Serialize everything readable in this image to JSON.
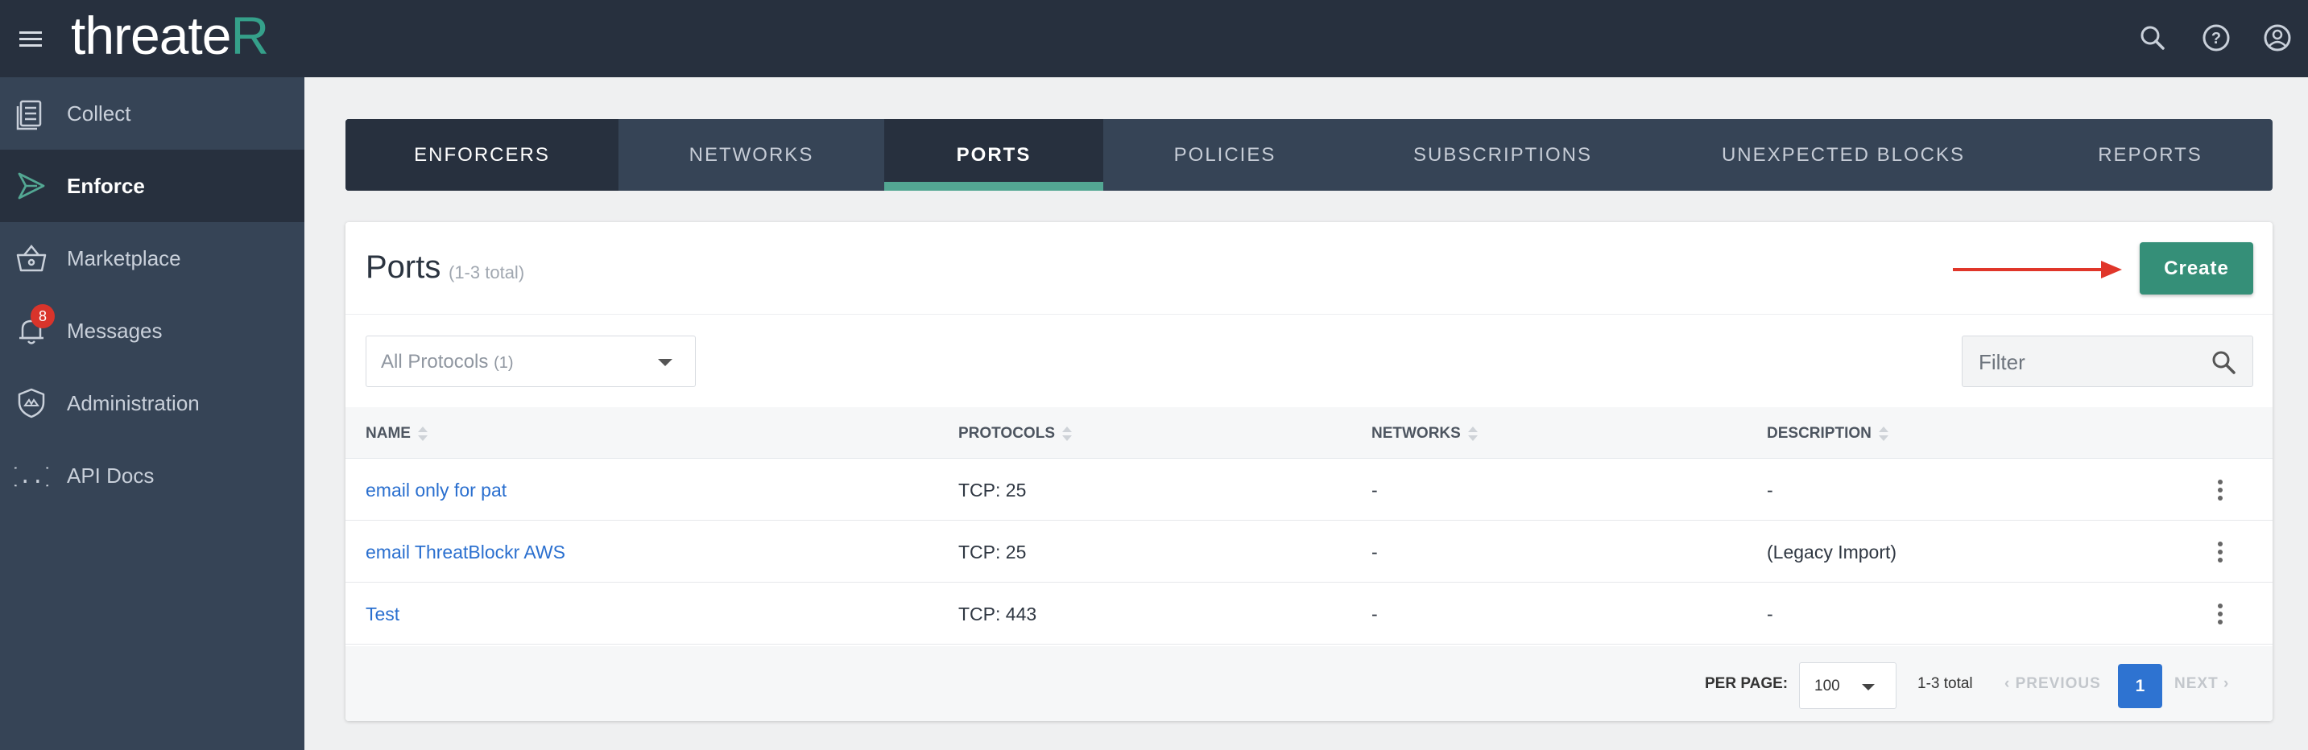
{
  "app": {
    "logo_prefix": "threate",
    "logo_accent": "R"
  },
  "topbar": {
    "icons": [
      "hamburger-menu-icon",
      "search-icon",
      "help-icon",
      "account-icon"
    ]
  },
  "sidebar": {
    "items": [
      {
        "label": "Collect",
        "icon": "collect-icon",
        "active": false
      },
      {
        "label": "Enforce",
        "icon": "enforce-icon",
        "active": true
      },
      {
        "label": "Marketplace",
        "icon": "basket-icon",
        "active": false
      },
      {
        "label": "Messages",
        "icon": "bell-icon",
        "active": false,
        "badge": "8"
      },
      {
        "label": "Administration",
        "icon": "shield-icon",
        "active": false
      },
      {
        "label": "API Docs",
        "icon": "braces-icon",
        "active": false
      }
    ]
  },
  "tabs": [
    {
      "label": "ENFORCERS"
    },
    {
      "label": "NETWORKS"
    },
    {
      "label": "PORTS",
      "active": true
    },
    {
      "label": "POLICIES"
    },
    {
      "label": "SUBSCRIPTIONS"
    },
    {
      "label": "UNEXPECTED BLOCKS"
    },
    {
      "label": "REPORTS"
    }
  ],
  "card": {
    "title": "Ports",
    "count": "(1-3 total)",
    "create_label": "Create",
    "protocol_select": {
      "label": "All Protocols",
      "count": "(1)"
    },
    "filter_placeholder": "Filter"
  },
  "table": {
    "columns": [
      "NAME",
      "PROTOCOLS",
      "NETWORKS",
      "DESCRIPTION"
    ],
    "rows": [
      {
        "name": "email only for pat",
        "protocols": "TCP: 25",
        "networks": "-",
        "description": "-"
      },
      {
        "name": "email ThreatBlockr AWS",
        "protocols": "TCP: 25",
        "networks": "-",
        "description": "(Legacy Import)"
      },
      {
        "name": "Test",
        "protocols": "TCP: 443",
        "networks": "-",
        "description": "-"
      }
    ]
  },
  "pagination": {
    "per_page_label": "PER PAGE:",
    "per_page_value": "100",
    "total": "1-3 total",
    "previous": "PREVIOUS",
    "next": "NEXT",
    "current_page": "1"
  },
  "colors": {
    "topbar": "#27303e",
    "sidebar": "#364456",
    "accent": "#53a793",
    "create_button": "#358f78",
    "link": "#2a6fcf",
    "arrow": "#e0362a"
  }
}
